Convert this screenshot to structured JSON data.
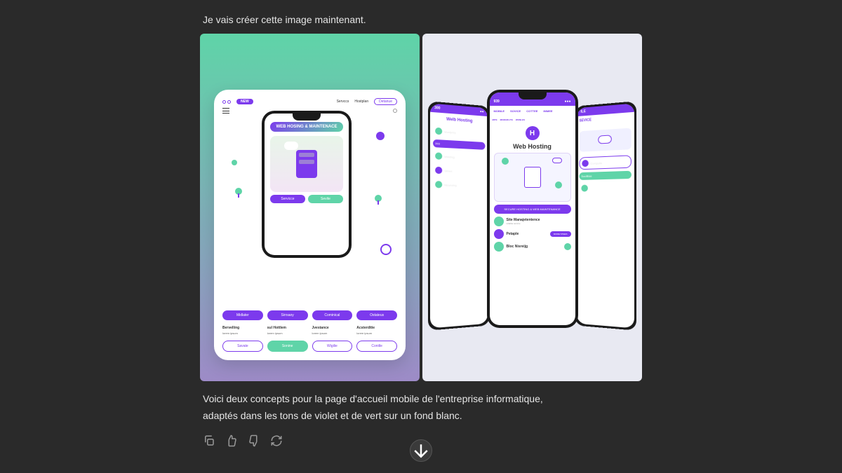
{
  "messages": {
    "intro": "Je vais créer cette image maintenant.",
    "outro_line1": "Voici deux concepts pour la page d'accueil mobile de l'entreprise informatique,",
    "outro_line2": "adaptés dans les tons de violet et de vert sur un fond blanc."
  },
  "left_concept": {
    "nav": {
      "tag": "NEW",
      "link1": "Servccs",
      "link2": "Hostplan",
      "btn": "Detanue"
    },
    "phone_badge": "WEB HOSING & MAINTENACE",
    "service1": "Servicce",
    "service2": "Sevite",
    "pills": [
      "Midlater",
      "Sirrsaoy",
      "Cominical",
      "Ostateus"
    ],
    "cols": [
      {
        "title": "Bervelling",
        "text": "lorem ipsum"
      },
      {
        "title": "sul Hottlem",
        "text": "lorem ipsum"
      },
      {
        "title": "Jvestance",
        "text": "lorem ipsum"
      },
      {
        "title": "Acsterditie",
        "text": "lorem ipsum"
      }
    ],
    "buttons": [
      "Savate",
      "Sonine",
      "Wigilie",
      "Conitle"
    ]
  },
  "right_concept": {
    "topbar": {
      "left": "939",
      "right": "●●●"
    },
    "tabs": [
      "MOBILE",
      "SOVICE",
      "COTTEE",
      "IMMEE"
    ],
    "subtabs": [
      "MITE",
      "MOMARLITE",
      "WONLES"
    ],
    "logo_letter": "H",
    "hero": "Web Hosting",
    "feature_pill": "SECURE HOSTING & WEB MAINTENANCE",
    "features": [
      {
        "title": "Site Manajetentence",
        "sub": "reliable service",
        "btn": ""
      },
      {
        "title": "Petaple",
        "sub": "",
        "btn": "MORE STEES"
      },
      {
        "title": "Bloc Nisreijg",
        "sub": "",
        "btn": ""
      }
    ],
    "left_phone": {
      "topnum": "300",
      "title": "Welb Hosting",
      "items": [
        "Muniprey",
        "393",
        "Weletog",
        "Sitriee",
        "Nisunsing"
      ]
    },
    "right_phone": {
      "tag": "ILE",
      "label": "SEVICE",
      "items": [
        "Compulte",
        "Socillbse"
      ]
    }
  },
  "actions": {
    "copy": "Copy",
    "like": "Like",
    "dislike": "Dislike",
    "regenerate": "Regenerate"
  },
  "colors": {
    "purple": "#7c3aed",
    "green": "#5fd4a8",
    "bg_dark": "#2a2a2a"
  }
}
